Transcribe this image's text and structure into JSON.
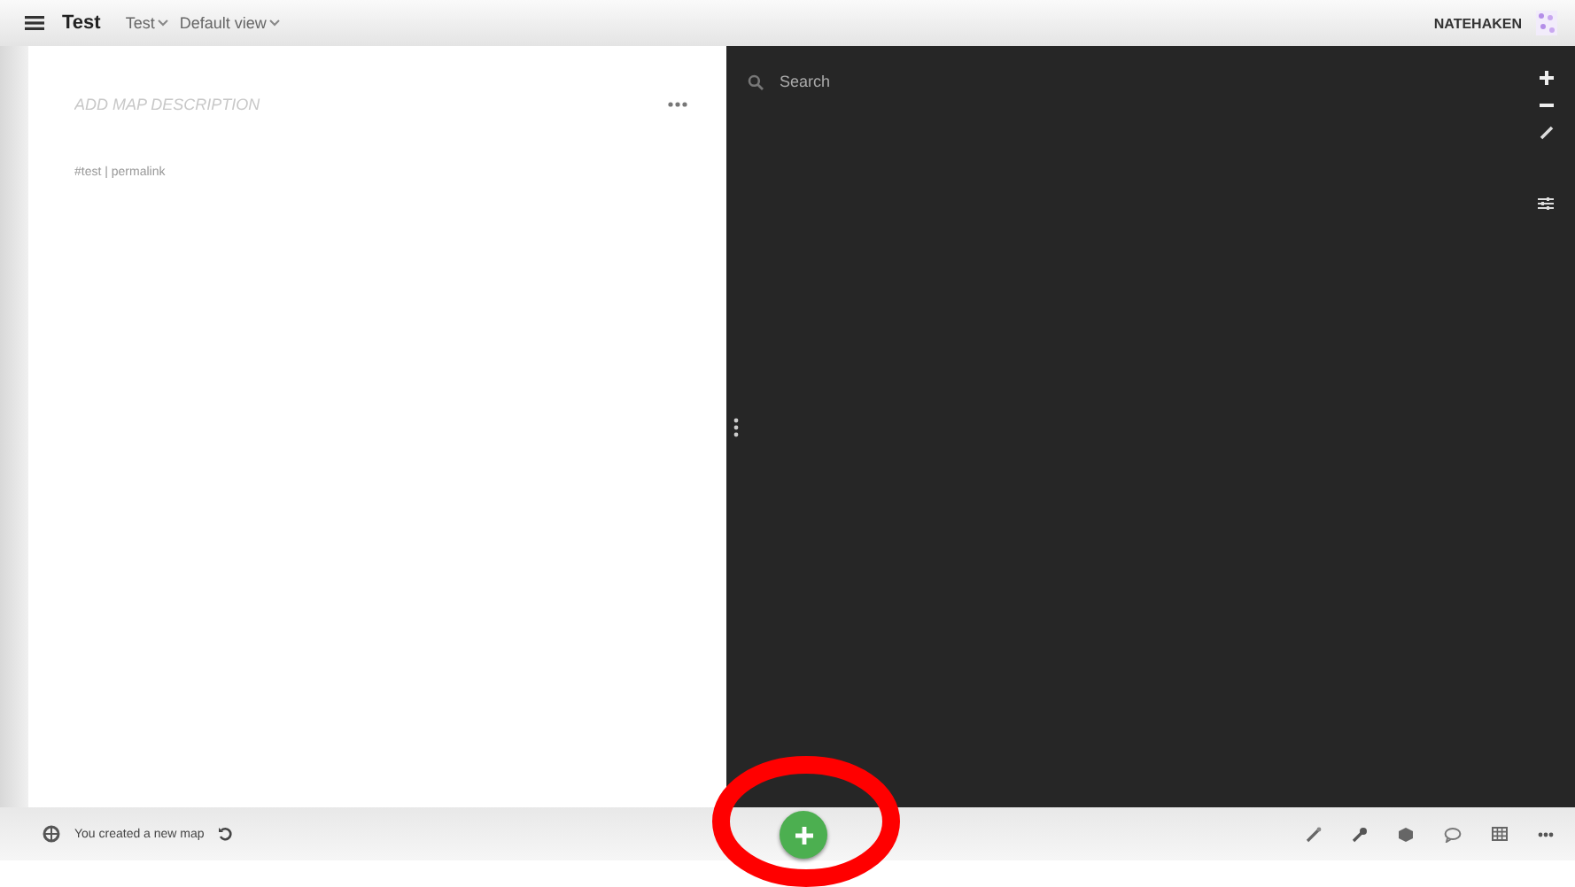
{
  "header": {
    "title": "Test",
    "menus": [
      {
        "label": "Test"
      },
      {
        "label": "Default view"
      }
    ],
    "user": "NATEHAKEN"
  },
  "side_panel": {
    "description": {
      "placeholder": "ADD MAP DESCRIPTION"
    },
    "tags": "#test | permalink"
  },
  "map": {
    "search": {
      "placeholder": "Search"
    }
  },
  "footer": {
    "status": "You created a new map"
  },
  "annotation": {
    "kind": "ellipse",
    "color": "#ff0000"
  }
}
